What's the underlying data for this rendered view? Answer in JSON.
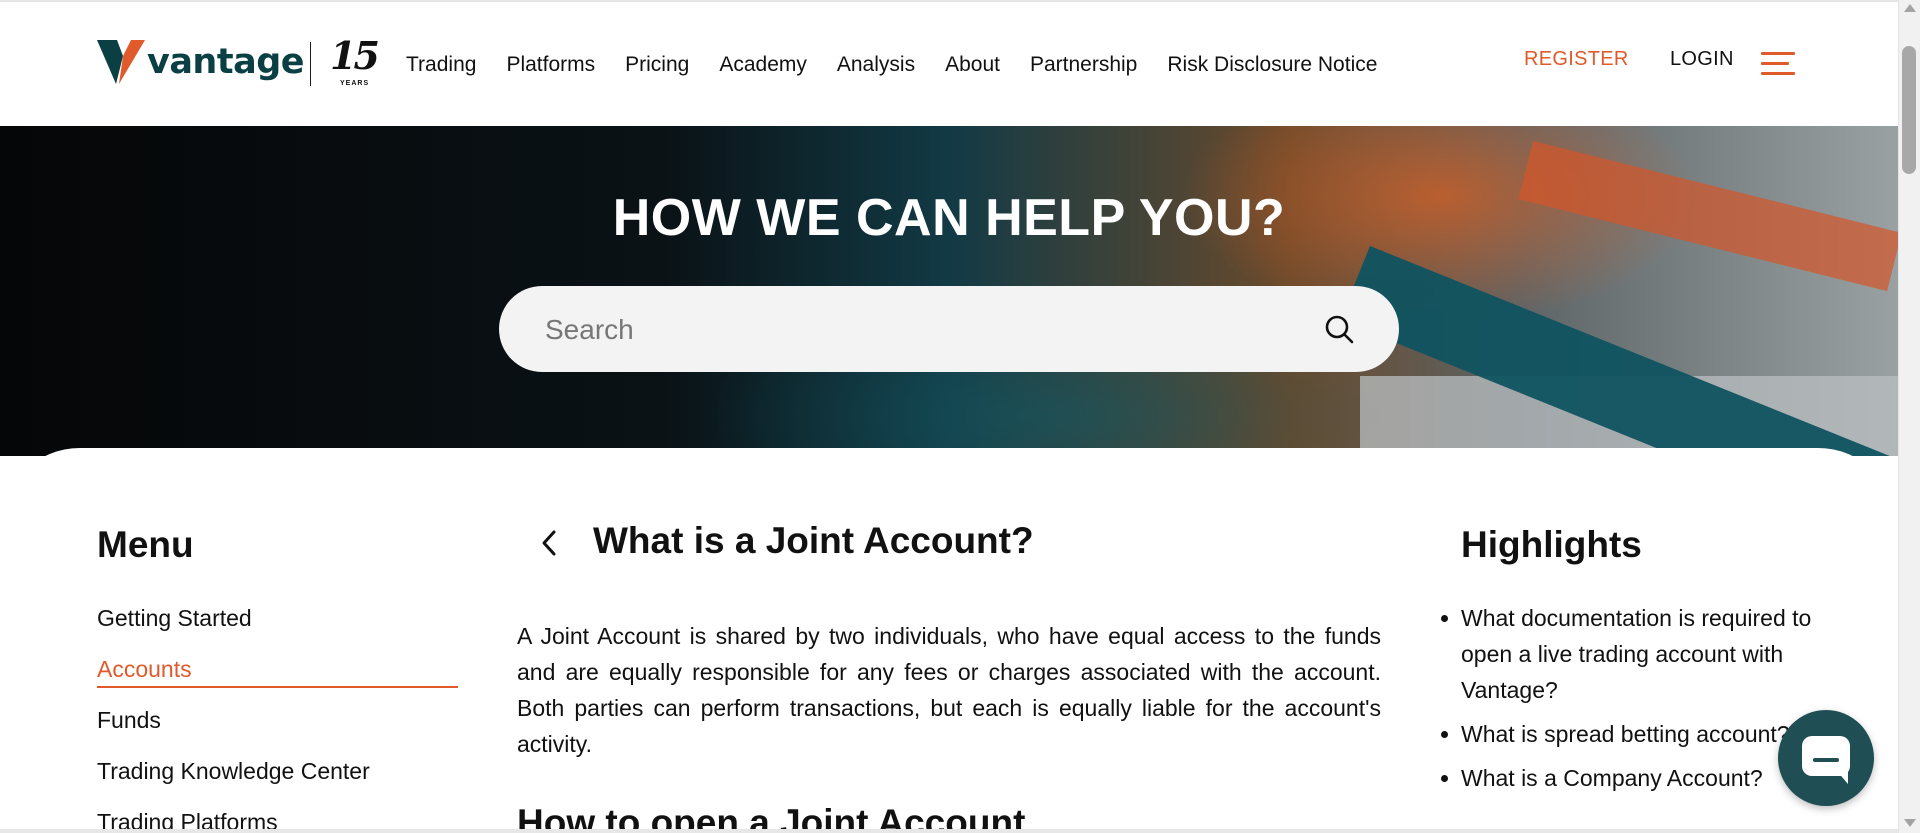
{
  "header": {
    "logo_text": "vantage",
    "badge_number": "15",
    "badge_caption": "YEARS",
    "nav": [
      "Trading",
      "Platforms",
      "Pricing",
      "Academy",
      "Analysis",
      "About",
      "Partnership",
      "Risk Disclosure Notice"
    ],
    "register_label": "REGISTER",
    "login_label": "LOGIN",
    "accent_color": "#e05a2b",
    "brand_color": "#0a3f43"
  },
  "hero": {
    "title": "HOW WE CAN HELP YOU?",
    "search_placeholder": "Search"
  },
  "menu": {
    "title": "Menu",
    "items": [
      "Getting Started",
      "Accounts",
      "Funds",
      "Trading Knowledge Center",
      "Trading Platforms"
    ],
    "active_item": "Accounts"
  },
  "article": {
    "title": "What is a Joint Account?",
    "body": "A Joint Account is shared by two individuals, who have equal access to the funds and are equally responsible for any fees or charges associated with the account. Both parties can perform transactions, but each is equally liable for the account's activity.",
    "subheading": "How to open a Joint Account"
  },
  "highlights": {
    "title": "Highlights",
    "items": [
      "What documentation is required to open a live trading account with Vantage?",
      "What is spread betting account?",
      "What is a Company Account?"
    ]
  },
  "icons": {
    "search": "search-icon",
    "back": "chevron-left-icon",
    "menu": "hamburger-menu-icon",
    "chat": "chat-icon"
  }
}
